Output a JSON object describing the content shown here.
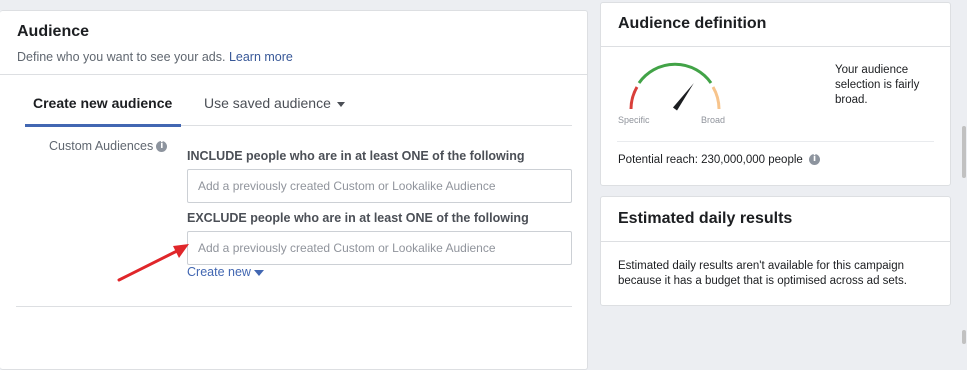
{
  "audience": {
    "title": "Audience",
    "subtitle": "Define who you want to see your ads.",
    "learn_more": "Learn more",
    "tabs": [
      {
        "label": "Create new audience"
      },
      {
        "label": "Use saved audience"
      }
    ],
    "custom_audiences_label": "Custom Audiences",
    "include": {
      "title": "INCLUDE people who are in at least ONE of the following",
      "placeholder": "Add a previously created Custom or Lookalike Audience"
    },
    "exclude": {
      "title": "EXCLUDE people who are in at least ONE of the following",
      "placeholder": "Add a previously created Custom or Lookalike Audience"
    },
    "create_new": "Create new"
  },
  "definition": {
    "title": "Audience definition",
    "gauge_specific": "Specific",
    "gauge_broad": "Broad",
    "gauge_level": 0.7,
    "description": "Your audience selection is fairly broad.",
    "potential_reach": "Potential reach: 230,000,000 people"
  },
  "daily": {
    "title": "Estimated daily results",
    "message": "Estimated daily results aren't available for this campaign because it has a budget that is optimised across ad sets."
  },
  "colors": {
    "accent": "#4267b2",
    "link": "#385898",
    "gauge_red": "#d93f3a",
    "gauge_green": "#42a347",
    "gauge_orange": "#f7c48c",
    "annotation_arrow": "#e0262a"
  },
  "icons": {
    "info": "info-icon",
    "caret": "caret-down-icon"
  }
}
